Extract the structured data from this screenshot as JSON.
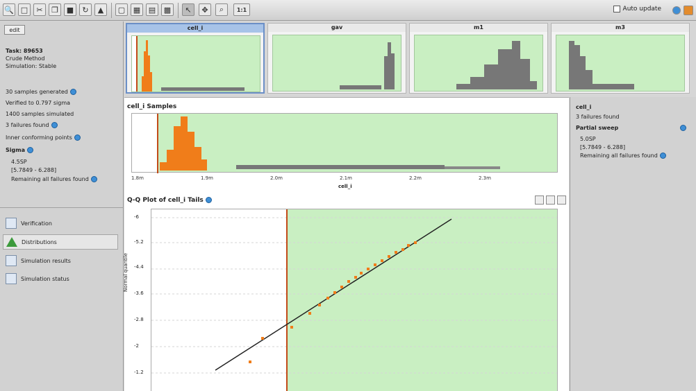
{
  "toolbar": {
    "auto_update_label": "Auto update"
  },
  "left_panel": {
    "edit_label": "edit",
    "task": "Task: 89653",
    "method": "Crude Method",
    "status": "Simulation: Stable",
    "samples_generated": "30 samples generated",
    "verified": "Verified to 0.797 sigma",
    "samples_simulated": "1400 samples simulated",
    "failures_found": "3 failures found",
    "inner_points": "Inner conforming points",
    "sigma_label": "Sigma",
    "sigma_value": "4.5SP",
    "interval": "[5.7849 - 6.288]",
    "remaining": "Remaining all failures found"
  },
  "nav": [
    {
      "label": "Verification",
      "icon": "verification-icon"
    },
    {
      "label": "Distributions",
      "icon": "distributions-icon"
    },
    {
      "label": "Simulation results",
      "icon": "simulation-results-icon"
    },
    {
      "label": "Simulation status",
      "icon": "simulation-status-icon"
    }
  ],
  "thumbs": [
    {
      "title": "cell_i"
    },
    {
      "title": "gav"
    },
    {
      "title": "m1"
    },
    {
      "title": "m3"
    }
  ],
  "samples": {
    "title": "cell_i Samples",
    "ticks": [
      "1.8m",
      "1.9m",
      "2.0m",
      "2.1m",
      "2.2m",
      "2.3m"
    ],
    "xlabel": "cell_i"
  },
  "qq": {
    "title": "Q-Q Plot of cell_i Tails",
    "ylabel": "Normal quantile",
    "yticks": [
      "-6",
      "-5.2",
      "-4.4",
      "-3.6",
      "-2.8",
      "-2",
      "-1.2"
    ]
  },
  "right_panel": {
    "spec": "cell_i",
    "failures": "3 failures found",
    "partial_header": "Partial sweep",
    "sweep_value": "5.0SP",
    "sweep_interval": "[5.7849 - 6.288]",
    "remaining": "Remaining all failures found"
  },
  "colors": {
    "accent_orange": "#f07d1a",
    "green_region": "#c9efc2",
    "boundary": "#c24a17"
  }
}
